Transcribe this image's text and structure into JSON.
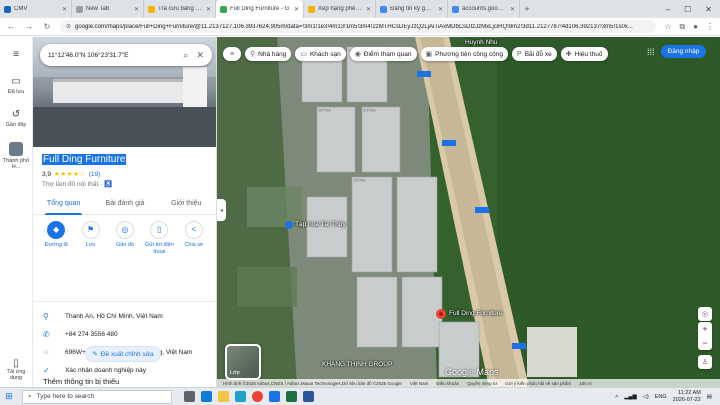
{
  "browser": {
    "tabs": [
      {
        "label": "CMV",
        "fav_color": "#1565c0",
        "active": false
      },
      {
        "label": "New Tab",
        "fav_color": "#9e9e9e",
        "active": false
      },
      {
        "label": "Tra cứu bảng giá nhà đ...",
        "fav_color": "#f4b400",
        "active": false
      },
      {
        "label": "Full Ding Furniture - G",
        "fav_color": "#34a853",
        "active": true
      },
      {
        "label": "Xếp hạng phê duyệt",
        "fav_color": "#f4b400",
        "active": false
      },
      {
        "label": "Đăng tin ký gửi nhà đ...",
        "fav_color": "#4285f4",
        "active": false
      },
      {
        "label": "accounts.google.com",
        "fav_color": "#4285f4",
        "active": false
      }
    ],
    "url": "google.com/maps/place/Full+Ding+Furniture/@11.2137127,106.3937624,905m/data=!3m1!1e3!4m13!1m5!3m4!2zMTHCsDEyJzQ2LjAiTiAxMDbCsDIzJzMxLjciRQ!8m2!3d11.2127787!4d106.392137!3m5!1s0x..."
  },
  "rail": {
    "items": [
      {
        "icon": "≡",
        "label": ""
      },
      {
        "icon": "▭",
        "label": "Đã lưu"
      },
      {
        "icon": "↺",
        "label": "Gần đây"
      }
    ],
    "recent_thumb_label": "Thành phố H...",
    "bottom_label": "Tải ứng dụng"
  },
  "panel": {
    "search_query": "11°12'46.0\"N 106°23'31.7\"E",
    "place_name": "Full Ding Furniture",
    "rating": "3,9",
    "stars": "★★★★☆",
    "review_count": "(19)",
    "category": "Thợ làm đồ nội thất · ♿",
    "tabs": [
      "Tổng quan",
      "Bài đánh giá",
      "Giới thiệu"
    ],
    "actions": [
      {
        "icon": "◆",
        "label": "Đường đi"
      },
      {
        "icon": "⚑",
        "label": "Lưu"
      },
      {
        "icon": "◎",
        "label": "Gần đó"
      },
      {
        "icon": "▯",
        "label": "Gửi tới điện thoại"
      },
      {
        "icon": "<",
        "label": "Chia sẻ"
      }
    ],
    "info": [
      {
        "icon": "⚲",
        "text": "Thanh An, Hồ Chí Minh, Việt Nam"
      },
      {
        "icon": "✆",
        "text": "+84 274 3556 480"
      },
      {
        "icon": "⁘",
        "text": "696W+F7 Thanh An, Bình Dương, Việt Nam"
      },
      {
        "icon": "✓",
        "text": "Xác nhận doanh nghiệp này"
      }
    ],
    "suggest_edit": "Đề xuất chỉnh sửa",
    "more_info": "Thêm thông tin bị thiếu"
  },
  "map": {
    "chips": [
      {
        "icon": "🍴",
        "label": "Nhà hàng"
      },
      {
        "icon": "🛏",
        "label": "Khách sạn"
      },
      {
        "icon": "📷",
        "label": "Điểm tham quan"
      },
      {
        "icon": "🚌",
        "label": "Phương tiện công cộng"
      },
      {
        "icon": "P",
        "label": "Bãi đỗ xe"
      },
      {
        "icon": "💊",
        "label": "Hiệu thuố"
      }
    ],
    "sign_in": "Đăng nhập",
    "layers_label": "Lớp",
    "labels": {
      "shop": "Tạp hoá Tài Thủy",
      "place": "Full Ding Furniture",
      "group": "KHANG THỊNH GROUP",
      "top": "Huynh Nhu"
    },
    "road_badges": [
      "DT744",
      "DT744",
      "DT744",
      "DT744",
      "DT744"
    ],
    "attribution": [
      "Hình ảnh ©2026 Airbus,CNES / Airbus,Maxar Technologies,Dữ liệu bản đồ ©2026 Google",
      "Việt Nam",
      "Điều khoản",
      "Quyền riêng tư",
      "Gửi ý kiến phản hồi về sản phẩm",
      "100 m"
    ],
    "google_logo": "Google Maps"
  },
  "taskbar": {
    "search_placeholder": "Type here to search",
    "lang": "ENG",
    "time": "11:22 AM",
    "date": "2026-07-22"
  }
}
